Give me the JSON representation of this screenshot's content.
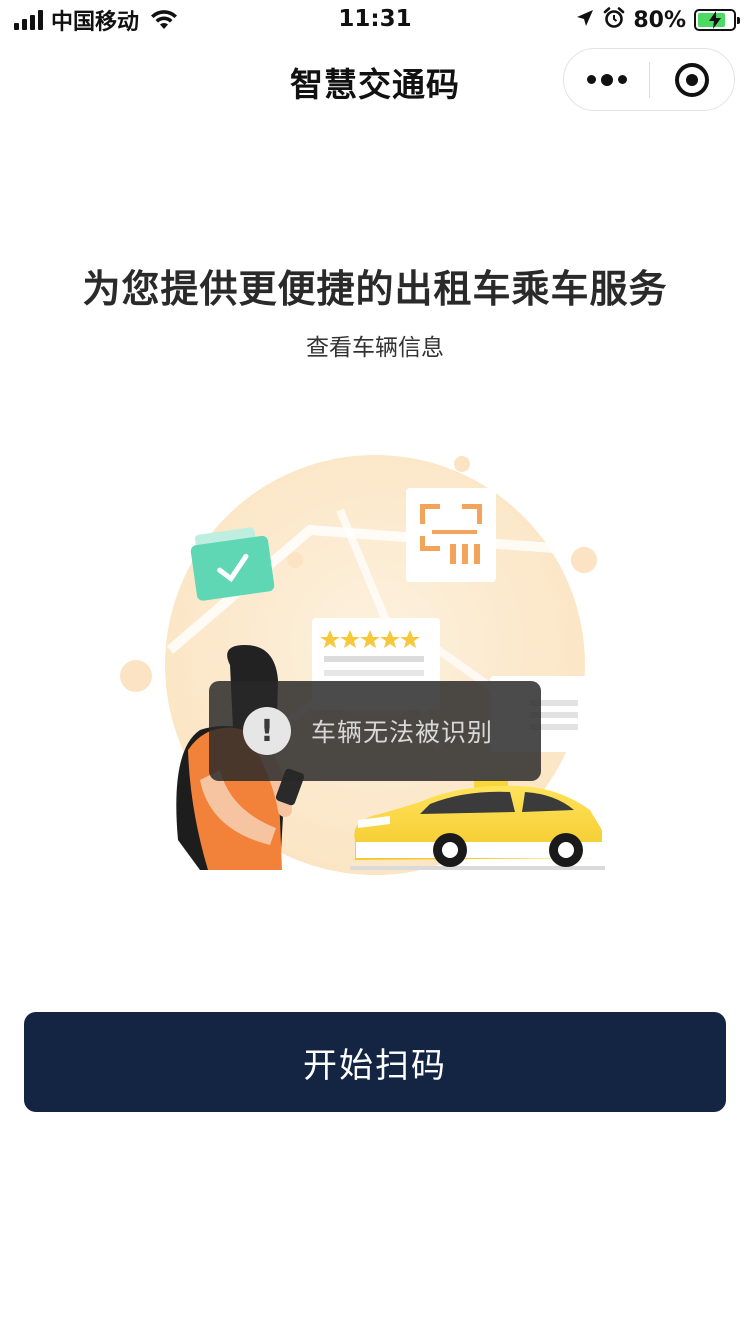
{
  "status_bar": {
    "carrier": "中国移动",
    "time": "11:31",
    "battery_percent": "80%",
    "battery_level": 0.8,
    "icons": [
      "signal-icon",
      "wifi-icon",
      "location-icon",
      "alarm-icon",
      "battery-charging-icon"
    ]
  },
  "nav": {
    "title": "智慧交通码",
    "capsule_icons": [
      "more-dots-icon",
      "close-target-icon"
    ]
  },
  "content": {
    "headline": "为您提供更便捷的出租车乘车服务",
    "subline": "查看车辆信息"
  },
  "toast": {
    "icon": "exclamation-icon",
    "message": "车辆无法被识别"
  },
  "actions": {
    "scan_label": "开始扫码"
  },
  "colors": {
    "primary_button": "#142443",
    "taxi_yellow": "#f8d63c",
    "accent_orange": "#f2823a",
    "wallet_green": "#5fd7b4"
  }
}
